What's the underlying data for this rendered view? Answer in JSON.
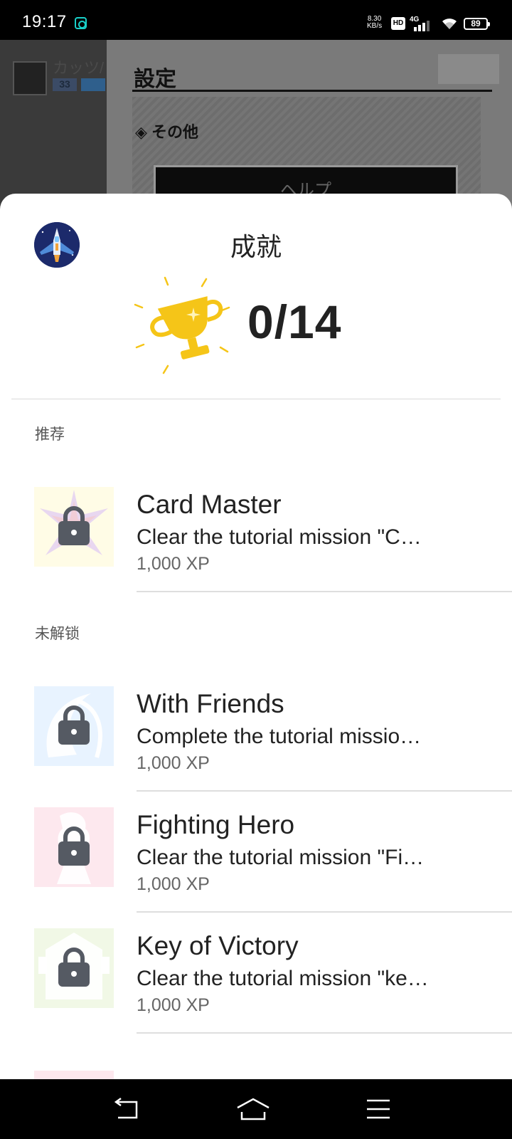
{
  "status_bar": {
    "time": "19:17",
    "net_speed_value": "8.30",
    "net_speed_unit": "KB/s",
    "hd_label": "HD",
    "network_label": "4G",
    "battery": "89"
  },
  "background_app": {
    "player_name": "カッツ/",
    "player_level": "33",
    "settings_title": "設定",
    "section_label": "その他",
    "help_button": "ヘルプ"
  },
  "sheet": {
    "title": "成就",
    "score": "0/14",
    "trophy_color": "#F5C518",
    "sections": {
      "recommended": "推荐",
      "locked": "未解锁"
    },
    "achievements": [
      {
        "name": "Card Master",
        "description": "Clear the tutorial mission \"C…",
        "xp": "1,000 XP",
        "thumb_color": "#FFFCE6",
        "art_color": "#E8D7F0"
      },
      {
        "name": "With Friends",
        "description": "Complete the tutorial missio…",
        "xp": "1,000 XP",
        "thumb_color": "#E8F3FF",
        "art_color": "#FFFFFF"
      },
      {
        "name": "Fighting Hero",
        "description": "Clear the tutorial mission \"Fi…",
        "xp": "1,000 XP",
        "thumb_color": "#FDE8EE",
        "art_color": "#FFFFFF"
      },
      {
        "name": "Key of Victory",
        "description": "Clear the tutorial mission \"ke…",
        "xp": "1,000 XP",
        "thumb_color": "#F1F8E6",
        "art_color": "#FFFFFF"
      }
    ]
  },
  "nav_bar": {
    "back_icon": "back-icon",
    "home_icon": "home-icon",
    "menu_icon": "menu-icon"
  }
}
